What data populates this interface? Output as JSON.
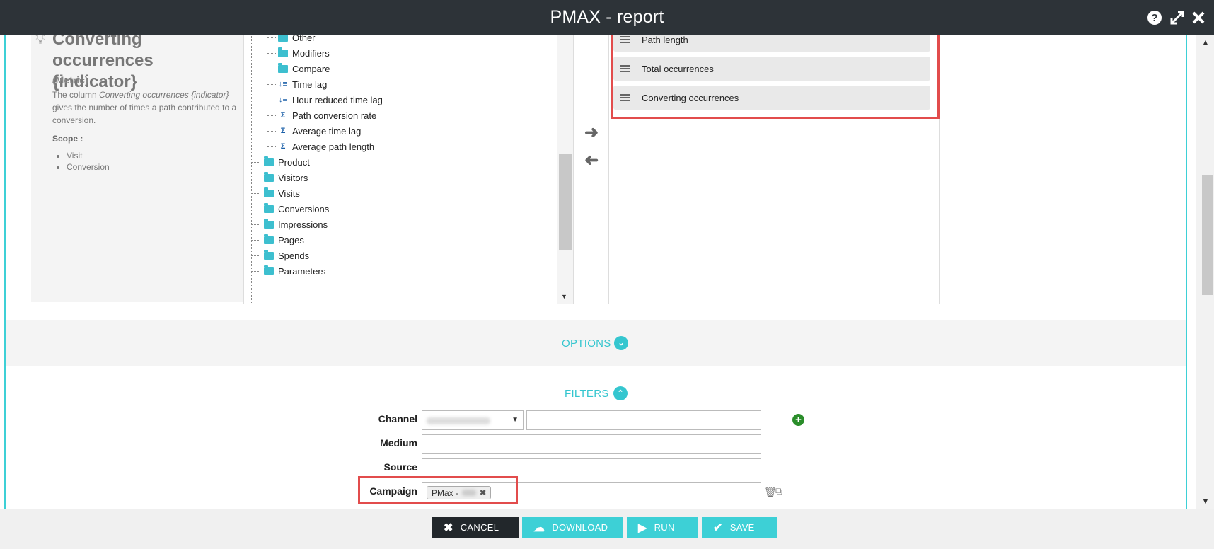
{
  "window": {
    "title": "PMAX - report",
    "help_icon": "question-circle-icon",
    "expand_icon": "expand-arrows-icon",
    "close_icon": "close-x-icon"
  },
  "description": {
    "title": "Converting occurrences {indicator}",
    "type": "(Metric)",
    "text_prefix": "The column ",
    "text_term": "Converting occurrences {indicator}",
    "text_suffix": " gives the number of times a path contributed to a conversion.",
    "scope_label": "Scope",
    "scope_items": [
      "Visit",
      "Conversion"
    ]
  },
  "tree": {
    "children": [
      {
        "label": "Other",
        "icon": "folder"
      },
      {
        "label": "Modifiers",
        "icon": "folder"
      },
      {
        "label": "Compare",
        "icon": "folder"
      },
      {
        "label": "Time lag",
        "icon": "sort-metric"
      },
      {
        "label": "Hour reduced time lag",
        "icon": "sort-metric"
      },
      {
        "label": "Path conversion rate",
        "icon": "sum-metric"
      },
      {
        "label": "Average time lag",
        "icon": "sum-metric"
      },
      {
        "label": "Average path length",
        "icon": "sum-metric"
      }
    ],
    "roots": [
      {
        "label": "Product"
      },
      {
        "label": "Visitors"
      },
      {
        "label": "Visits"
      },
      {
        "label": "Conversions"
      },
      {
        "label": "Impressions"
      },
      {
        "label": "Pages"
      },
      {
        "label": "Spends"
      },
      {
        "label": "Parameters"
      }
    ]
  },
  "selected_columns": [
    {
      "label": "Path length"
    },
    {
      "label": "Total occurrences"
    },
    {
      "label": "Converting occurrences"
    }
  ],
  "options": {
    "label": "OPTIONS"
  },
  "filters": {
    "label": "FILTERS",
    "channel_label": "Channel",
    "medium_label": "Medium",
    "source_label": "Source",
    "campaign_label": "Campaign",
    "campaign_chip": "PMax -"
  },
  "footer": {
    "cancel": "CANCEL",
    "download": "DOWNLOAD",
    "run": "RUN",
    "save": "SAVE"
  },
  "colors": {
    "accent": "#35c6cf",
    "titlebar": "#2d3338",
    "highlight": "#e24c4c",
    "cancel_bg": "#22272b"
  }
}
